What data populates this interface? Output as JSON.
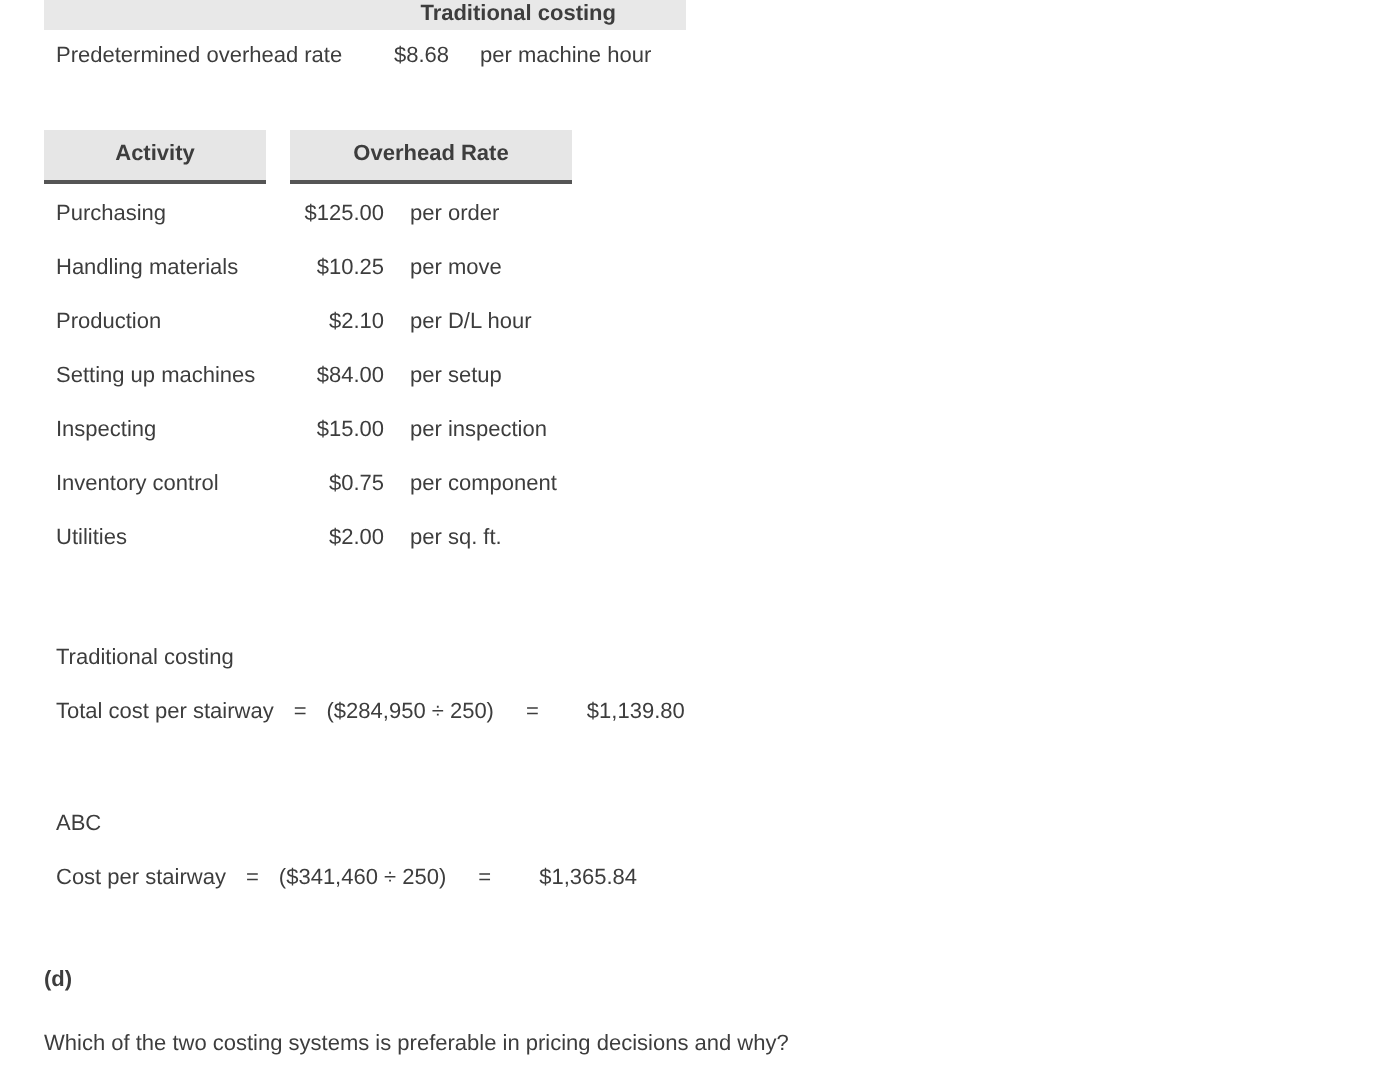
{
  "top_table": {
    "column_header": "Traditional costing",
    "row": {
      "label": "Predetermined overhead rate",
      "amount": "$8.68",
      "unit": "per machine hour"
    }
  },
  "rates_table": {
    "columns": [
      "Activity",
      "Overhead Rate"
    ],
    "rows": [
      {
        "activity": "Purchasing",
        "amount": "$125.00",
        "unit": "per order"
      },
      {
        "activity": "Handling materials",
        "amount": "$10.25",
        "unit": "per move"
      },
      {
        "activity": "Production",
        "amount": "$2.10",
        "unit": "per D/L hour"
      },
      {
        "activity": "Setting up machines",
        "amount": "$84.00",
        "unit": "per setup"
      },
      {
        "activity": "Inspecting",
        "amount": "$15.00",
        "unit": "per inspection"
      },
      {
        "activity": "Inventory control",
        "amount": "$0.75",
        "unit": "per component"
      },
      {
        "activity": "Utilities",
        "amount": "$2.00",
        "unit": "per sq. ft."
      }
    ]
  },
  "calculations": [
    {
      "heading": "Traditional costing",
      "label": "Total cost per stairway",
      "eq1": "=",
      "formula": "($284,950 ÷ 250)",
      "eq2": "=",
      "result": "$1,139.80"
    },
    {
      "heading": "ABC",
      "label": "Cost per stairway",
      "eq1": "=",
      "formula": "($341,460 ÷ 250)",
      "eq2": "=",
      "result": "$1,365.84"
    }
  ],
  "part": {
    "label": "(d)",
    "question": "Which of the two costing systems is preferable in pricing decisions and why?"
  }
}
